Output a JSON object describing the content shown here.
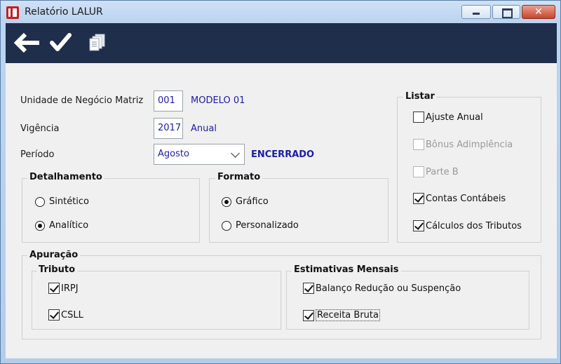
{
  "window": {
    "title": "Relatório LALUR",
    "close_glyph": "✕"
  },
  "toolbar": {
    "items": [
      {
        "icon": "back-arrow-icon"
      },
      {
        "icon": "checkmark-icon"
      },
      {
        "icon": "documents-icon"
      }
    ]
  },
  "form": {
    "unit_label": "Unidade de Negócio Matriz",
    "unit_code": "001",
    "unit_name": "MODELO 01",
    "vigencia_label": "Vigência",
    "vigencia_year": "2017",
    "vigencia_type": "Anual",
    "period_label": "Período",
    "period_value": "Agosto",
    "period_status": "ENCERRADO"
  },
  "detalhamento": {
    "title": "Detalhamento",
    "options": [
      {
        "label": "Sintético",
        "selected": false
      },
      {
        "label": "Analítico",
        "selected": true
      }
    ]
  },
  "formato": {
    "title": "Formato",
    "options": [
      {
        "label": "Gráfico",
        "selected": true
      },
      {
        "label": "Personalizado",
        "selected": false
      }
    ]
  },
  "listar": {
    "title": "Listar",
    "items": [
      {
        "label": "Ajuste Anual",
        "checked": false,
        "enabled": true
      },
      {
        "label": "Bônus Adimplência",
        "checked": false,
        "enabled": false
      },
      {
        "label": "Parte B",
        "checked": false,
        "enabled": false
      },
      {
        "label": "Contas Contábeis",
        "checked": true,
        "enabled": true
      },
      {
        "label": "Cálculos dos Tributos",
        "checked": true,
        "enabled": true
      }
    ]
  },
  "apuracao": {
    "title": "Apuração",
    "tributo": {
      "title": "Tributo",
      "items": [
        {
          "label": "IRPJ",
          "checked": true
        },
        {
          "label": "CSLL",
          "checked": true
        }
      ]
    },
    "estimativas": {
      "title": "Estimativas Mensais",
      "items": [
        {
          "label": "Balanço Redução ou Suspenção",
          "checked": true
        },
        {
          "label": "Receita Bruta",
          "checked": true,
          "focused": true
        }
      ]
    }
  },
  "colors": {
    "toolbar_bg": "#1f2e4b",
    "value_text": "#1c1ca8",
    "panel_bg": "#f0f0f0"
  }
}
